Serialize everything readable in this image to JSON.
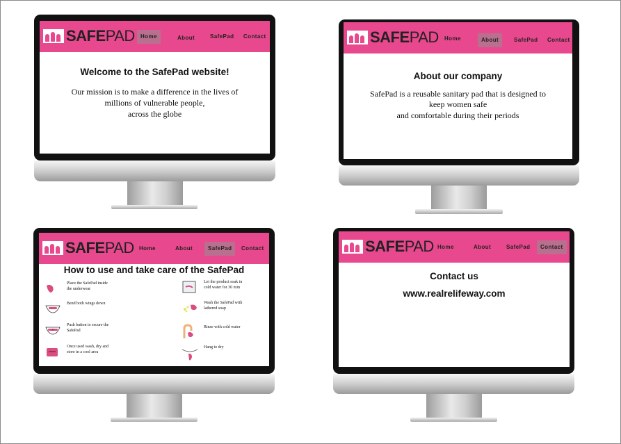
{
  "brand": {
    "logo_bold": "SAFE",
    "logo_thin": "PAD",
    "accent": "#e8488d",
    "active_tab": "#b9708f"
  },
  "nav": {
    "home": "Home",
    "about": "About",
    "safepad": "SafePad",
    "contact": "Contact"
  },
  "home": {
    "title": "Welcome to the SafePad website!",
    "line1": "Our mission is to make a difference in the lives of",
    "line2": "millions of vulnerable people,",
    "line3": "across the globe"
  },
  "about": {
    "title": "About our company",
    "line1": "SafePad is a reusable sanitary pad that is designed to",
    "line2": "keep women safe",
    "line3": "and comfortable during their periods"
  },
  "safepad": {
    "title": "How to use and take care of the SafePad",
    "steps_left": [
      {
        "text": "Place the SafePad inside the underwear",
        "icon": "underwear-pad-icon"
      },
      {
        "text": "Bend both wings down",
        "icon": "wings-icon"
      },
      {
        "text": "Push button to secure the SafePad",
        "icon": "button-icon"
      },
      {
        "text": "Once used wash, dry and store in a cool area",
        "icon": "storage-bag-icon"
      }
    ],
    "steps_right": [
      {
        "text": "Let the product soak in cold water for 30 min",
        "icon": "soak-icon"
      },
      {
        "text": "Wash the SafePad with lathered soap",
        "icon": "soap-icon"
      },
      {
        "text": "Rinse with cold water",
        "icon": "tap-icon"
      },
      {
        "text": "Hang to dry",
        "icon": "hanger-icon"
      }
    ]
  },
  "contact": {
    "title": "Contact us",
    "url": "www.realrelifeway.com"
  }
}
